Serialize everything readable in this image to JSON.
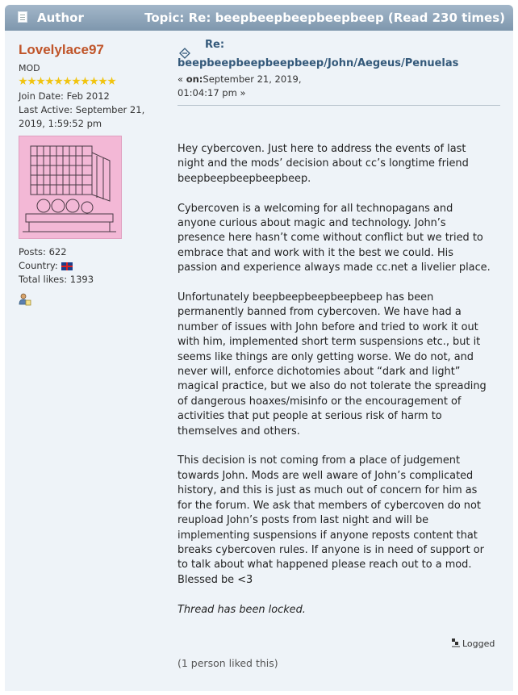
{
  "header": {
    "author_label": "Author",
    "topic_label": "Topic: Re: beepbeepbeepbeepbeep  (Read 230 times)"
  },
  "poster": {
    "name": "Lovelylace97",
    "role": "MOD",
    "join_date": "Join Date: Feb 2012",
    "last_active_1": "Last Active: September 21,",
    "last_active_2": "2019, 1:59:52 pm",
    "posts": "Posts: 622",
    "country": "Country:",
    "total_likes": "Total likes: 1393",
    "star_count": 11
  },
  "post": {
    "subject_prefix": "Re:",
    "subject_title": "beepbeepbeepbeepbeep/John/Aegeus/Penuelas",
    "date_prefix": "« ",
    "date_on": "on:",
    "date_1": "September 21, 2019,",
    "date_2": "01:04:17 pm »",
    "paragraphs": [
      "Hey cybercoven. Just here to address the events of last night and the mods’ decision about cc’s longtime friend beepbeepbeepbeepbeep.",
      "Cybercoven is a welcoming for all technopagans and anyone curious about magic and technology. John’s presence here hasn’t come without conflict but we tried to embrace that and work with it the best we could. His passion and experience always made cc.net a livelier place.",
      "Unfortunately beepbeepbeepbeepbeep has been permanently banned from cybercoven. We have had a number of issues with John before and tried to work it out with him, implemented short term suspensions etc., but it seems like things are only getting worse. We do not, and never will, enforce dichotomies about “dark and light” magical practice, but we also do not tolerate the spreading of dangerous hoaxes/misinfo or the encouragement of activities that put people at serious risk of harm to themselves and others.",
      "This decision is not coming from a place of judgement towards John. Mods are well aware of John’s complicated history, and this is just as much out of concern for him as for the forum. We ask that members of cybercoven do not reupload John’s posts from last night and will be implementing suspensions if anyone reposts content that breaks cybercoven rules. If anyone is in need of support or to talk about what happened please reach out to a mod. Blessed be <3"
    ],
    "locked_note": "Thread has been locked.",
    "logged": "Logged",
    "likes": "(1 person liked this)"
  },
  "colors": {
    "header_top": "#a3b7c9",
    "header_bottom": "#7e97ad",
    "panel_bg": "#eef3f8",
    "poster_name": "#c0552a",
    "link": "#34597a"
  }
}
